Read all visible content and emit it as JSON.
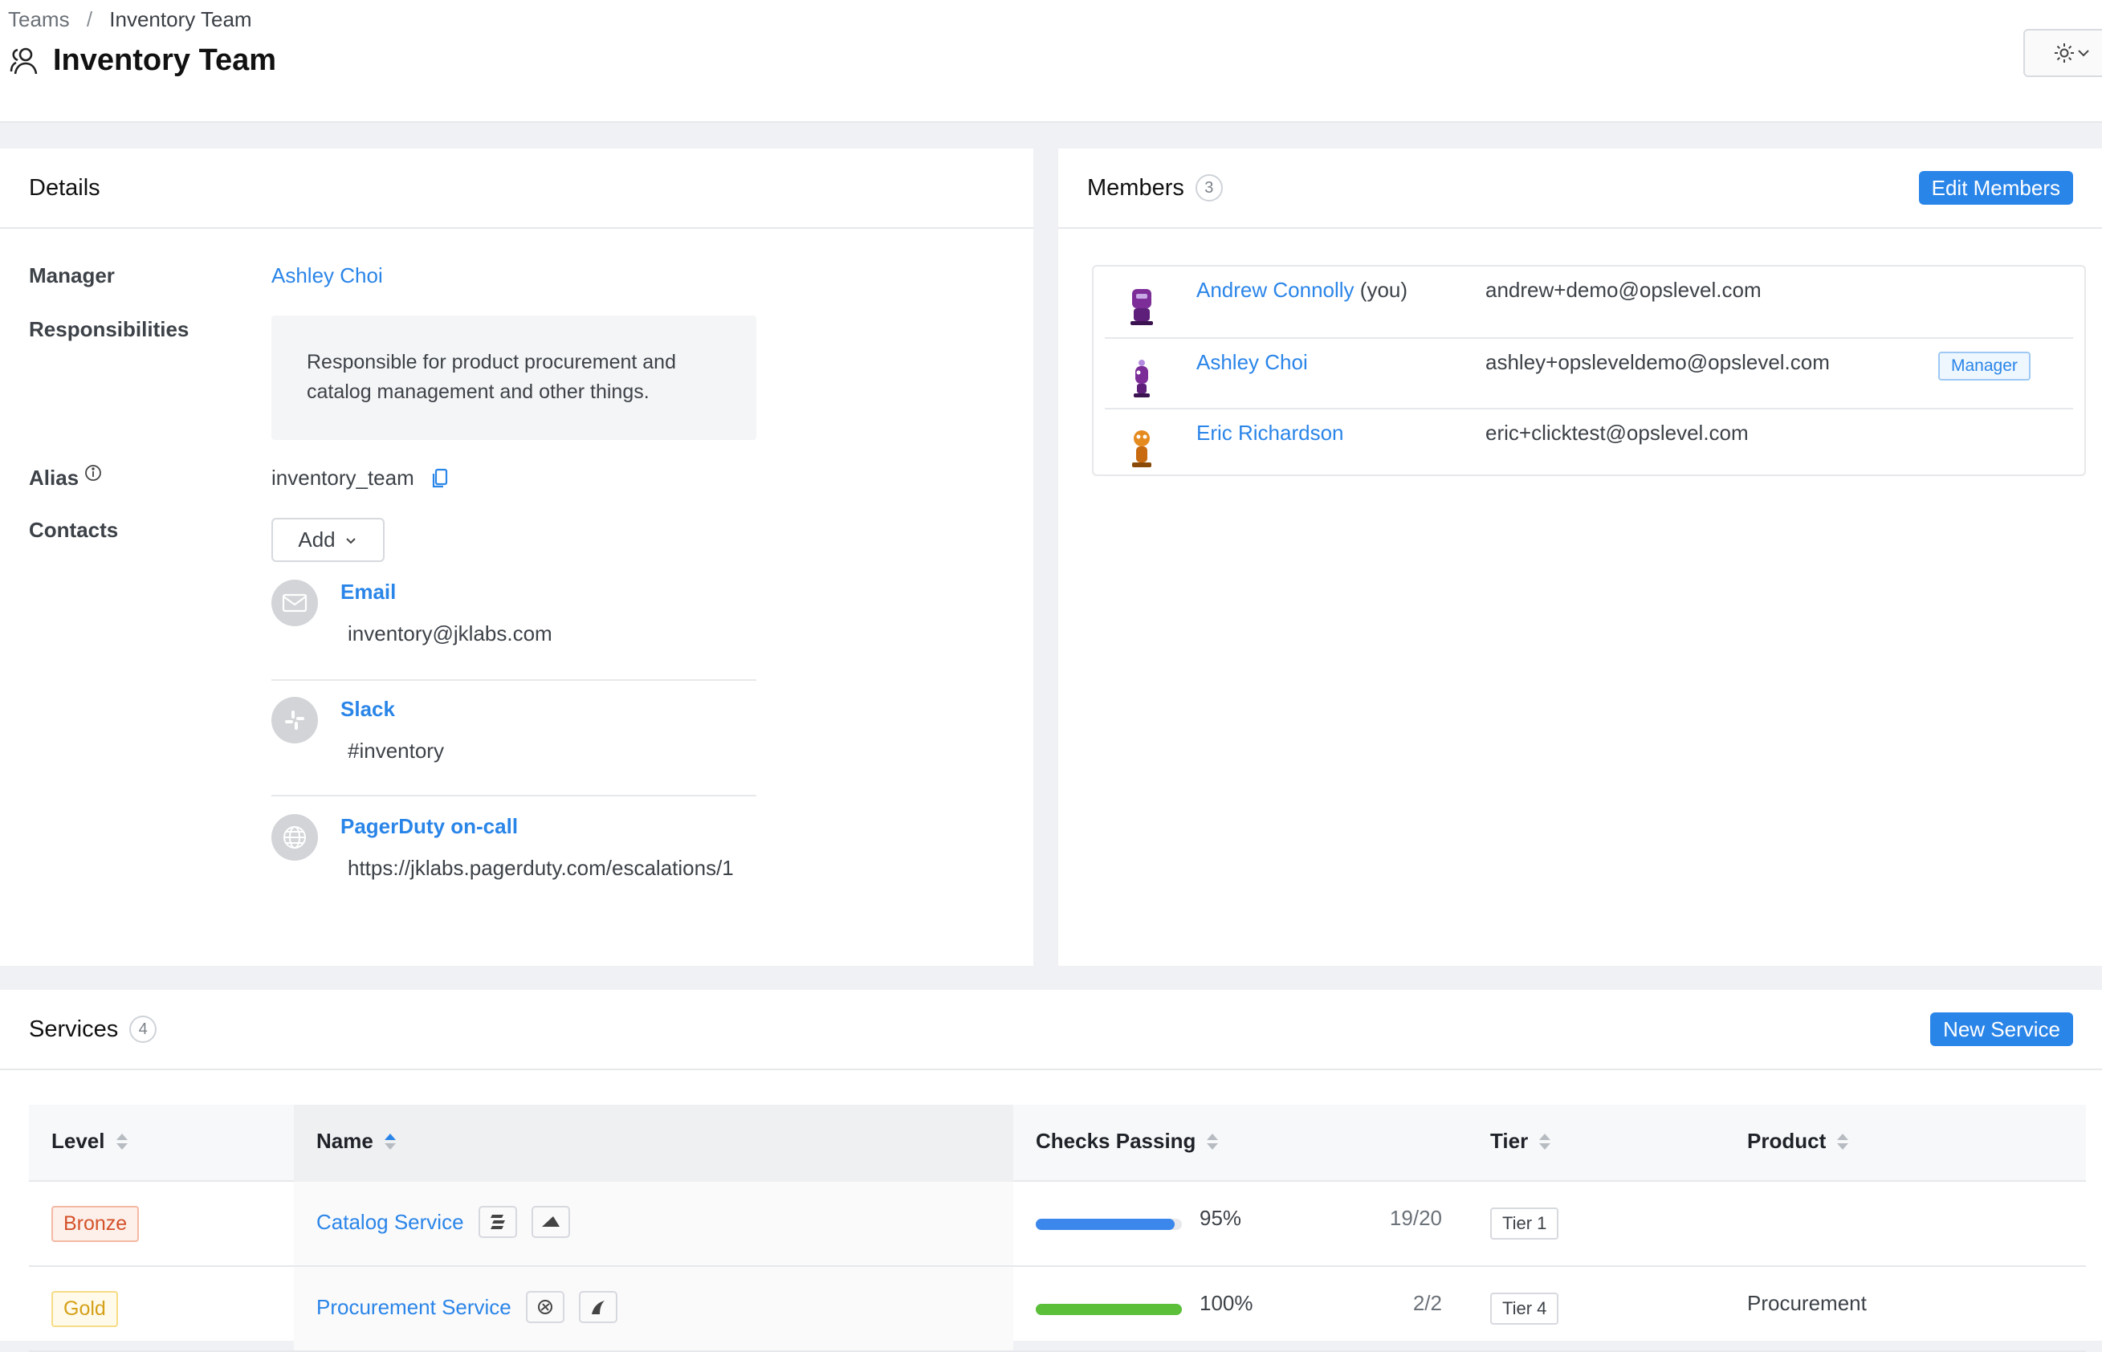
{
  "breadcrumb": {
    "parent": "Teams",
    "separator": "/",
    "current": "Inventory Team"
  },
  "page": {
    "title": "Inventory Team"
  },
  "details": {
    "heading": "Details",
    "manager_label": "Manager",
    "manager_value": "Ashley Choi",
    "responsibilities_label": "Responsibilities",
    "responsibilities_text": "Responsible for product procurement and catalog management and other things.",
    "alias_label": "Alias",
    "alias_value": "inventory_team",
    "contacts_label": "Contacts",
    "add_button": "Add",
    "contacts": [
      {
        "name": "Email",
        "value": "inventory@jklabs.com",
        "icon": "mail-icon"
      },
      {
        "name": "Slack",
        "value": "#inventory",
        "icon": "slack-icon"
      },
      {
        "name": "PagerDuty on-call",
        "value": "https://jklabs.pagerduty.com/escalations/1",
        "icon": "globe-icon"
      }
    ]
  },
  "members": {
    "heading": "Members",
    "count": "3",
    "edit_button": "Edit Members",
    "rows": [
      {
        "name": "Andrew Connolly",
        "suffix": "(you)",
        "email": "andrew+demo@opslevel.com",
        "badge": ""
      },
      {
        "name": "Ashley Choi",
        "suffix": "",
        "email": "ashley+opsleveldemo@opslevel.com",
        "badge": "Manager"
      },
      {
        "name": "Eric Richardson",
        "suffix": "",
        "email": "eric+clicktest@opslevel.com",
        "badge": ""
      }
    ]
  },
  "services": {
    "heading": "Services",
    "count": "4",
    "new_button": "New Service",
    "columns": [
      "Level",
      "Name",
      "Checks Passing",
      "Tier",
      "Product"
    ],
    "rows": [
      {
        "level": "Bronze",
        "name": "Catalog Service",
        "percent_label": "95%",
        "percent": 95,
        "fraction": "19/20",
        "tier": "Tier 1",
        "product": "",
        "bar_color": "#3b87ec"
      },
      {
        "level": "Gold",
        "name": "Procurement Service",
        "percent_label": "100%",
        "percent": 100,
        "fraction": "2/2",
        "tier": "Tier 4",
        "product": "Procurement",
        "bar_color": "#5bbf3a"
      }
    ]
  },
  "colors": {
    "accent": "#2a85e8",
    "bronze": "#d4512a",
    "gold": "#d4a017",
    "progress_blue": "#3b87ec",
    "progress_green": "#5bbf3a"
  }
}
